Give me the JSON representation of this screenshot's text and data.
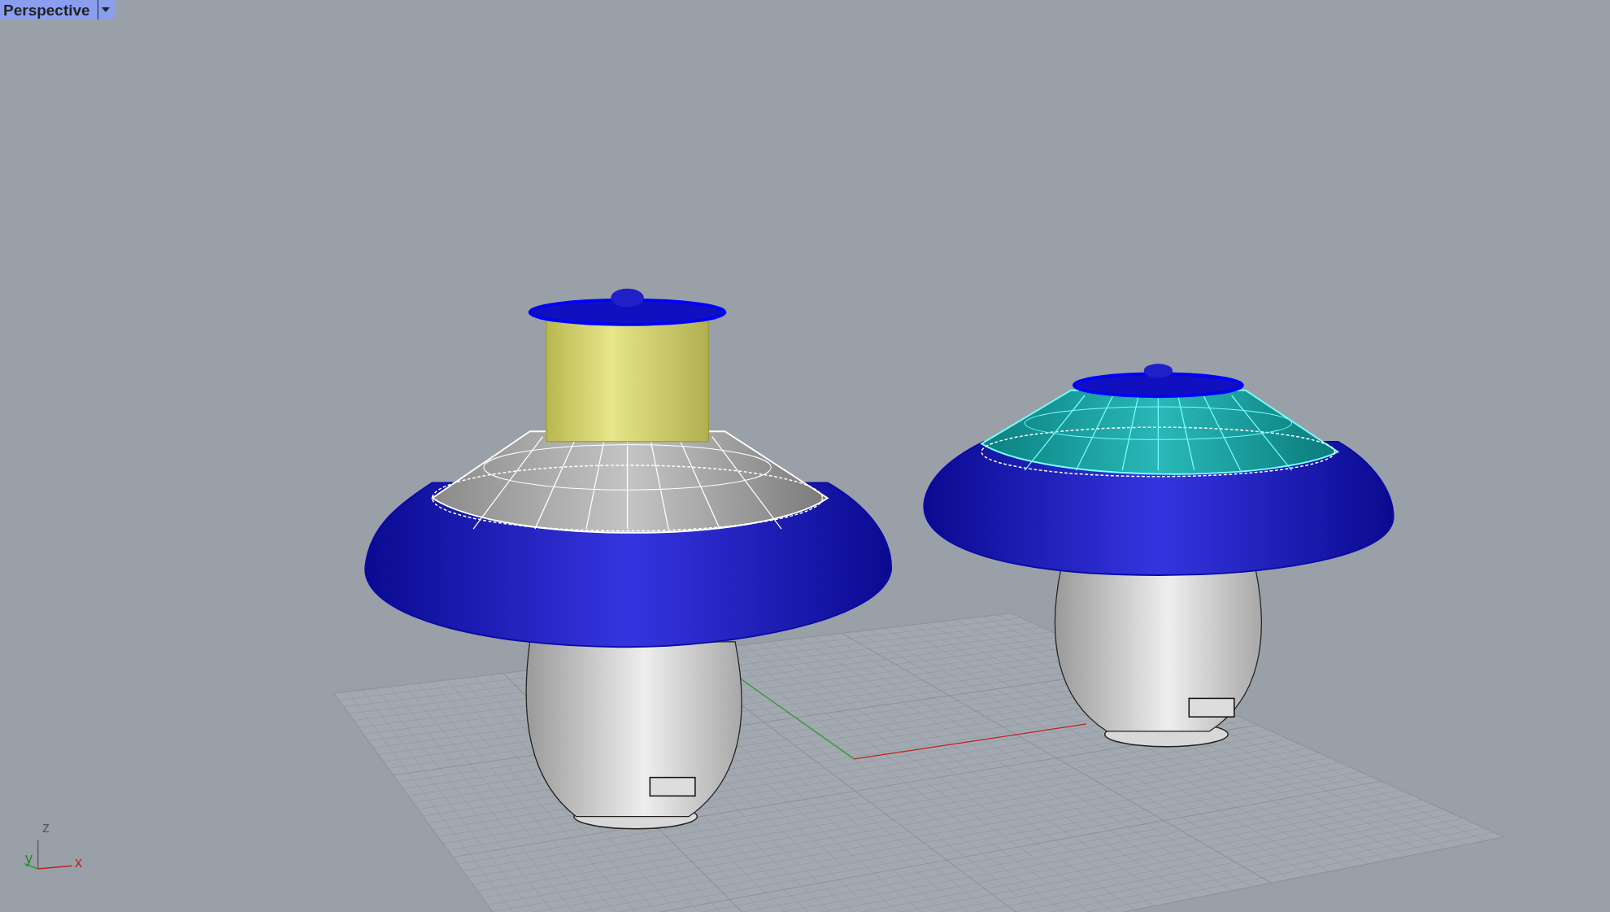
{
  "viewport": {
    "title": "Perspective"
  },
  "axis_labels": [
    {
      "label": "z",
      "color": "#5a5a5a"
    },
    {
      "label": "y",
      "color": "#1e8a2e"
    },
    {
      "label": "x",
      "color": "#c81e1e"
    }
  ]
}
